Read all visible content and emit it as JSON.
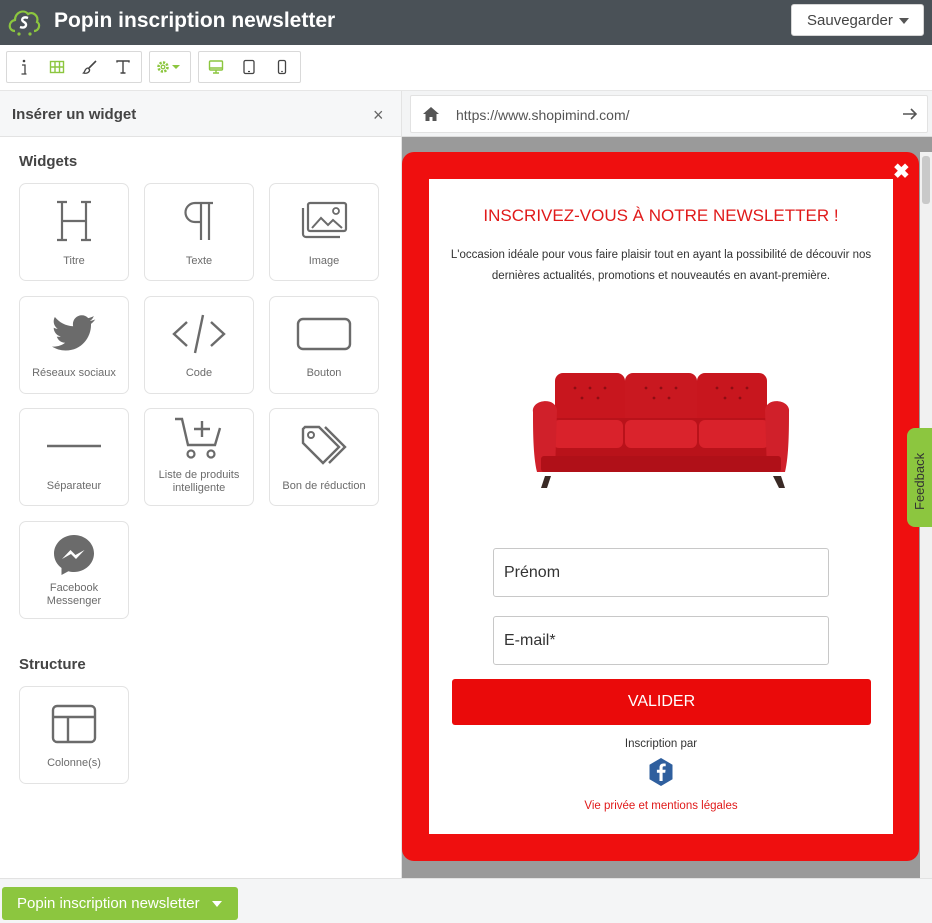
{
  "header": {
    "title": "Popin inscription newsletter",
    "save_label": "Sauvegarder"
  },
  "toolbar": {
    "icons": [
      "info-icon",
      "grid-icon",
      "brush-icon",
      "text-icon",
      "settings-icon",
      "desktop-icon",
      "tablet-icon",
      "mobile-icon"
    ],
    "accent": "#8cc63f"
  },
  "sidebar": {
    "title": "Insérer un widget",
    "close": "×",
    "widgets_title": "Widgets",
    "widgets": [
      {
        "label": "Titre",
        "icon": "heading-icon"
      },
      {
        "label": "Texte",
        "icon": "paragraph-icon"
      },
      {
        "label": "Image",
        "icon": "image-icon"
      },
      {
        "label": "Réseaux sociaux",
        "icon": "twitter-icon"
      },
      {
        "label": "Code",
        "icon": "code-icon"
      },
      {
        "label": "Bouton",
        "icon": "button-icon"
      },
      {
        "label": "Séparateur",
        "icon": "separator-icon"
      },
      {
        "label": "Liste de produits intelligente",
        "icon": "cart-icon"
      },
      {
        "label": "Bon de réduction",
        "icon": "tag-icon"
      },
      {
        "label": "Facebook Messenger",
        "icon": "messenger-icon"
      }
    ],
    "structure_title": "Structure",
    "structure": [
      {
        "label": "Colonne(s)",
        "icon": "columns-icon"
      }
    ]
  },
  "browser": {
    "url": "https://www.shopimind.com/"
  },
  "popin": {
    "title": "INSCRIVEZ-VOUS À NOTRE NEWSLETTER !",
    "text": "L'occasion idéale pour vous faire plaisir tout en ayant la possibilité de découvir nos dernières actualités, promotions et nouveautés en avant-première.",
    "first_name_placeholder": "Prénom",
    "email_placeholder": "E-mail*",
    "submit_label": "VALIDER",
    "inscription_label": "Inscription par",
    "privacy_label": "Vie privée et mentions légales",
    "close": "✖",
    "brand_color": "#ef0f0f"
  },
  "feedback_label": "Feedback",
  "bottom": {
    "label": "Popin inscription newsletter"
  }
}
